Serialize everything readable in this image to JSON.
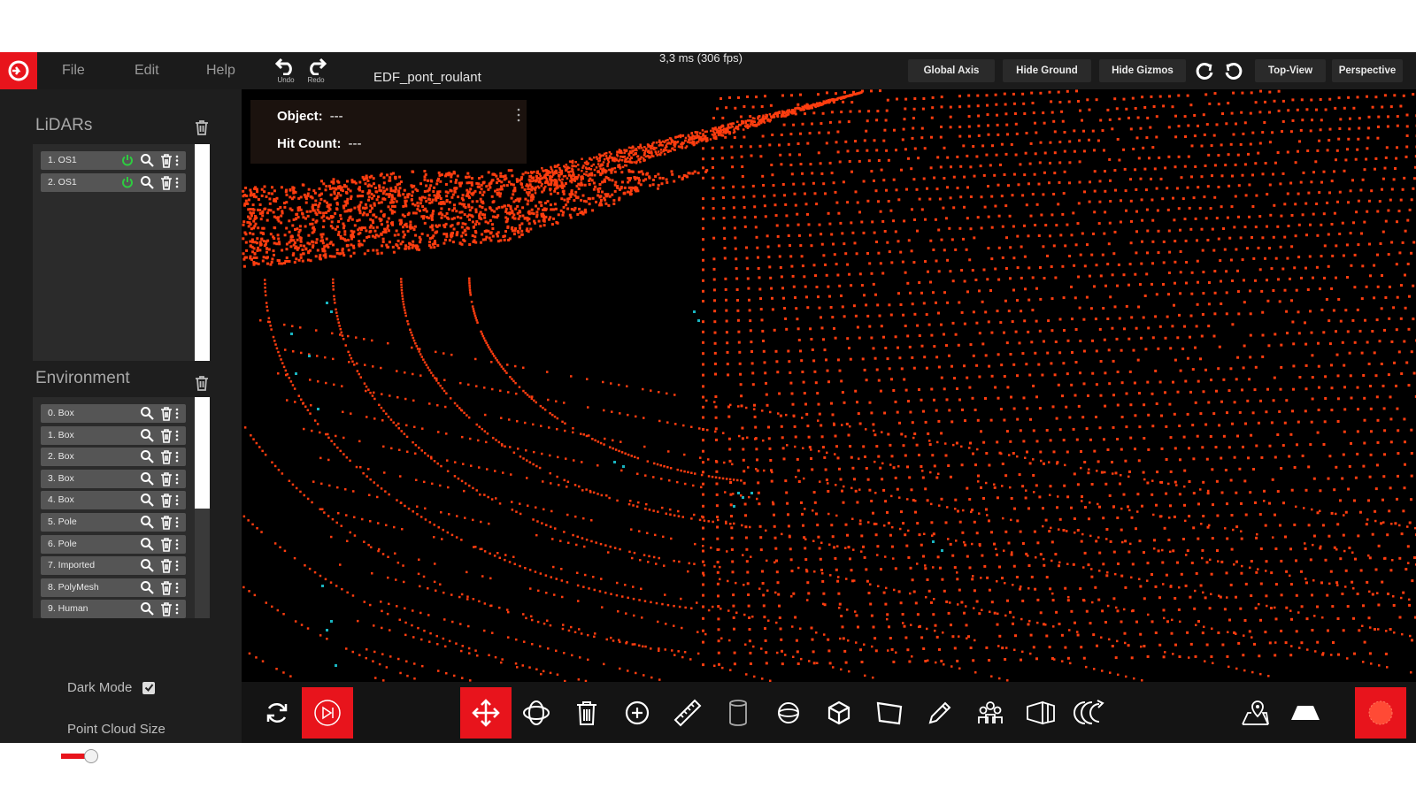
{
  "menu": {
    "file": "File",
    "edit": "Edit",
    "help": "Help"
  },
  "toolbar": {
    "undo": "Undo",
    "redo": "Redo"
  },
  "project_name": "EDF_pont_roulant",
  "fps": "3,3 ms (306 fps)",
  "view_buttons": {
    "global_axis": "Global Axis",
    "hide_ground": "Hide Ground",
    "hide_gizmos": "Hide Gizmos",
    "top_view": "Top-View",
    "perspective": "Perspective"
  },
  "lidars": {
    "title": "LiDARs",
    "items": [
      {
        "label": "1.  OS1"
      },
      {
        "label": "2.  OS1"
      }
    ]
  },
  "environment": {
    "title": "Environment",
    "items": [
      {
        "label": "0.  Box"
      },
      {
        "label": "1.  Box"
      },
      {
        "label": "2.  Box"
      },
      {
        "label": "3.  Box"
      },
      {
        "label": "4.  Box"
      },
      {
        "label": "5.  Pole"
      },
      {
        "label": "6.  Pole"
      },
      {
        "label": "7.  Imported"
      },
      {
        "label": "8.  PolyMesh"
      },
      {
        "label": "9.  Human"
      }
    ]
  },
  "settings": {
    "dark_mode_label": "Dark Mode",
    "dark_mode": true,
    "point_cloud_size_label": "Point Cloud Size",
    "point_cloud_size": 0.25
  },
  "info": {
    "object_label": "Object:",
    "object_value": "---",
    "hit_count_label": "Hit Count:",
    "hit_count_value": "---"
  },
  "colors": {
    "accent": "#e8141c",
    "points": "#ff3d0f",
    "ground_points": "#19b5c1",
    "power_on": "#2ecc40"
  },
  "icons": [
    "logo-icon",
    "undo-icon",
    "redo-icon",
    "rotate-cw-icon",
    "rotate-ccw-icon",
    "trash-icon",
    "search-icon",
    "power-icon",
    "kebab-icon",
    "refresh-icon",
    "play-record-icon",
    "move-icon",
    "orbit-icon",
    "add-circle-icon",
    "ruler-icon",
    "cylinder-icon",
    "sphere-icon",
    "cube-icon",
    "plane-icon",
    "pencil-icon",
    "group-icon",
    "wall-icon",
    "multi-orbit-icon",
    "map-pin-icon",
    "ground-icon",
    "record-icon"
  ]
}
